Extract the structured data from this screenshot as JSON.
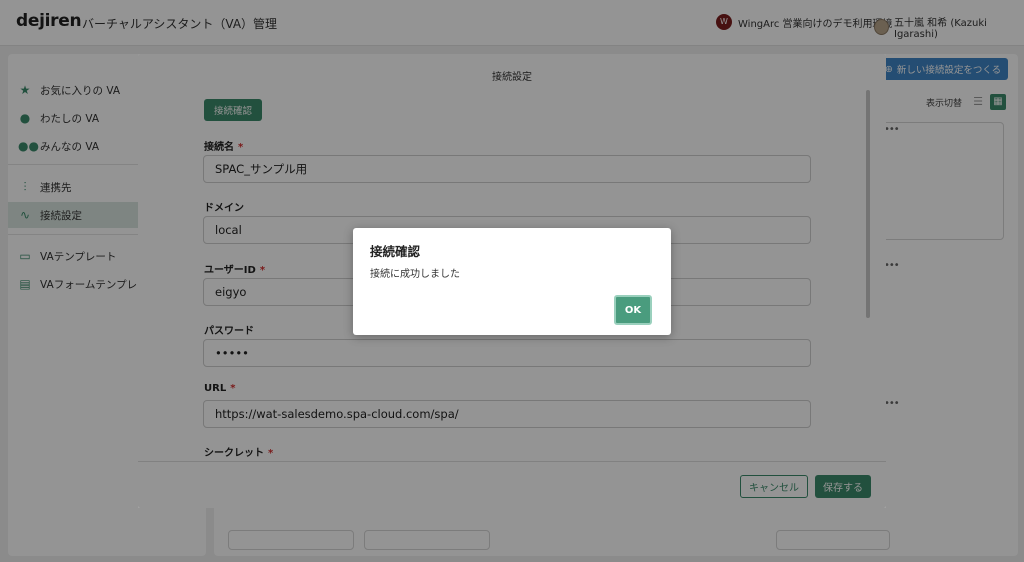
{
  "app": {
    "logo": "dejiren",
    "title": "バーチャルアシスタント（VA）管理",
    "org_badge": "W",
    "org_name": "WingArc 営業向けのデモ利用環境",
    "user_name": "五十嵐 和希 (Kazuki Igarashi)"
  },
  "sidebar": {
    "items": [
      {
        "label": "お気に入りの VA",
        "icon": "star-icon"
      },
      {
        "label": "わたしの VA",
        "icon": "person-icon"
      },
      {
        "label": "みんなの VA",
        "icon": "people-icon"
      },
      {
        "label": "連携先",
        "icon": "connector-icon"
      },
      {
        "label": "接続設定",
        "icon": "route-icon"
      },
      {
        "label": "VAテンプレート",
        "icon": "template-icon"
      },
      {
        "label": "VAフォームテンプレート",
        "icon": "form-template-icon"
      }
    ],
    "active_index": 4
  },
  "main": {
    "new_button": "新しい接続設定をつくる",
    "view_label": "表示切替"
  },
  "modal": {
    "title": "接続設定",
    "check_button": "接続確認",
    "fields": [
      {
        "label": "接続名",
        "required": "*",
        "value": "SPAC_サンプル用"
      },
      {
        "label": "ドメイン",
        "required": "",
        "value": "local"
      },
      {
        "label": "ユーザーID",
        "required": "*",
        "value": "eigyo"
      },
      {
        "label": "パスワード",
        "required": "",
        "value": "•••••"
      },
      {
        "label": "URL",
        "required": "*",
        "value": "https://wat-salesdemo.spa-cloud.com/spa/"
      },
      {
        "label": "シークレット",
        "required": "*",
        "value": ""
      }
    ],
    "cancel_button": "キャンセル",
    "save_button": "保存する"
  },
  "dialog": {
    "title": "接続確認",
    "message": "接続に成功しました",
    "ok_button": "OK"
  },
  "colors": {
    "accent": "#3c8b6b",
    "primary_blue": "#3f86c7",
    "required": "#d32f2f"
  }
}
